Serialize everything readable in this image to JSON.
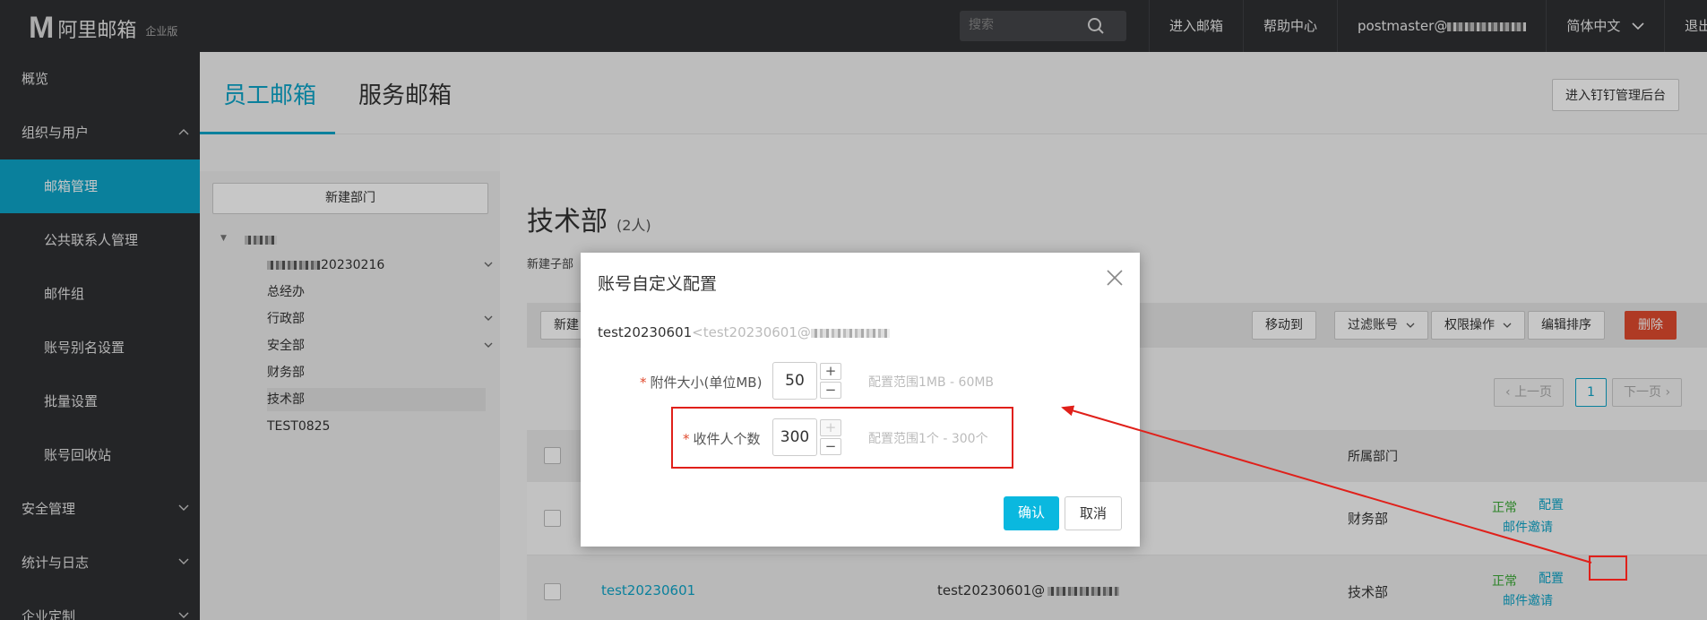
{
  "topbar": {
    "logo_mark": "M",
    "logo_text": "阿里邮箱",
    "logo_sub": "企业版",
    "search_placeholder": "搜索",
    "nav": [
      "进入邮箱",
      "帮助中心",
      "postmaster@",
      "简体中文",
      "退出"
    ]
  },
  "sidebar": {
    "items": [
      {
        "label": "概览"
      },
      {
        "label": "组织与用户"
      },
      {
        "label": "邮箱管理"
      },
      {
        "label": "公共联系人管理"
      },
      {
        "label": "邮件组"
      },
      {
        "label": "账号别名设置"
      },
      {
        "label": "批量设置"
      },
      {
        "label": "账号回收站"
      },
      {
        "label": "安全管理"
      },
      {
        "label": "统计与日志"
      },
      {
        "label": "企业定制"
      }
    ]
  },
  "tabs": {
    "staff": "员工邮箱",
    "service": "服务邮箱",
    "dingtalk_button": "进入钉钉管理后台"
  },
  "dept_panel": {
    "new_dept_button": "新建部门",
    "tree": [
      "20230216",
      "总经办",
      "行政部",
      "安全部",
      "财务部",
      "技术部",
      "TEST0825"
    ]
  },
  "content": {
    "dept_title": "技术部",
    "dept_count": "(2人)",
    "new_sub": "新建子部",
    "toolbar": {
      "new": "新建",
      "move": "移动到",
      "filter": "过滤账号",
      "perm": "权限操作",
      "sort": "编辑排序",
      "delete": "删除"
    },
    "pager": {
      "prev": "上一页",
      "page": "1",
      "next": "下一页"
    },
    "table_header": {
      "dept": "所属部门"
    },
    "rows": [
      {
        "account": "",
        "email": "",
        "dept": "财务部",
        "status": "正常",
        "config": "配置",
        "invite": "邮件邀请"
      },
      {
        "account": "test20230601",
        "email": "test20230601@",
        "dept": "技术部",
        "status": "正常",
        "config": "配置",
        "invite": "邮件邀请"
      }
    ]
  },
  "modal": {
    "title": "账号自定义配置",
    "account_name": "test20230601",
    "account_email": "<test20230601@",
    "attach_label": "附件大小(单位MB)",
    "attach_value": "50",
    "attach_hint": "配置范围1MB - 60MB",
    "recip_label": "收件人个数",
    "recip_value": "300",
    "recip_hint": "配置范围1个 - 300个",
    "confirm": "确认",
    "cancel": "取消",
    "stepper_plus": "+",
    "stepper_minus": "−"
  },
  "colors": {
    "accent": "#0ea5c8",
    "danger": "#e14b2f",
    "annotation": "#e0201a",
    "status_ok": "#3aaa35"
  }
}
